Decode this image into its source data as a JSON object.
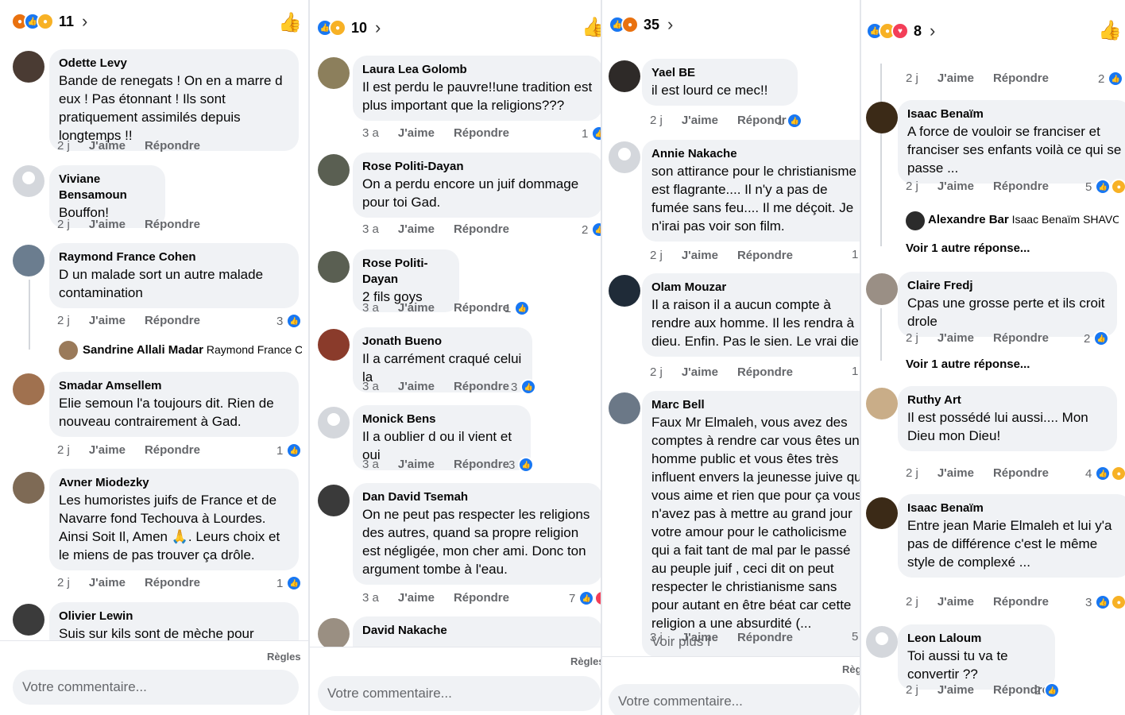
{
  "colors": {
    "like": "#1877f2",
    "haha": "#f7b125",
    "angry": "#e9710f",
    "love": "#f33e58",
    "bubble": "#f0f2f5"
  },
  "icons": {
    "like_button": "thumbs-up-icon",
    "chevron": "chevron-right-icon"
  },
  "panels": [
    {
      "reaction_count": "11",
      "comments": [
        {
          "name": "Odette Levy",
          "text": "Bande de renegats ! On en a marre d eux ! Pas étonnant ! Ils sont pratiquement assimilés depuis longtemps !!",
          "time": "2 j",
          "like": "J'aime",
          "reply": "Répondre",
          "count": ""
        },
        {
          "name": "Viviane Bensamoun",
          "text": "Bouffon!",
          "time": "2 j",
          "like": "J'aime",
          "reply": "Répondre",
          "count": ""
        },
        {
          "name": "Raymond France Cohen",
          "text": "D un malade sort un autre malade contamination",
          "time": "2 j",
          "like": "J'aime",
          "reply": "Répondre",
          "count": "3"
        },
        {
          "name": "Smadar Amsellem",
          "text": "Elie semoun l'a toujours dit. Rien de nouveau contrairement à Gad.",
          "time": "2 j",
          "like": "J'aime",
          "reply": "Répondre",
          "count": "1"
        },
        {
          "name": "Avner Miodezky",
          "text": "Les humoristes juifs de France et de Navarre fond Techouva à Lourdes. Ainsi Soit Il, Amen 🙏. Leurs choix et le miens de pas trouver ça drôle.",
          "time": "2 j",
          "like": "J'aime",
          "reply": "Répondre",
          "count": "1"
        },
        {
          "name": "Olivier Lewin",
          "text": "Suis sur kils sont de mèche pour",
          "time": "",
          "like": "",
          "reply": "",
          "count": ""
        }
      ],
      "replies": [
        {
          "name": "Sandrine Allali Madar",
          "text": "Raymond France Coh..."
        }
      ],
      "regles": "Règles",
      "placeholder": "Votre commentaire..."
    },
    {
      "reaction_count": "10",
      "comments": [
        {
          "name": "Laura Lea Golomb",
          "text": "Il est perdu le pauvre!!une tradition est plus important que la religions???",
          "time": "3 a",
          "like": "J'aime",
          "reply": "Répondre",
          "count": "1"
        },
        {
          "name": "Rose Politi-Dayan",
          "text": "On a perdu encore un juif dommage pour toi Gad.",
          "time": "3 a",
          "like": "J'aime",
          "reply": "Répondre",
          "count": "2"
        },
        {
          "name": "Rose Politi-Dayan",
          "text": "2 fils goys",
          "time": "3 a",
          "like": "J'aime",
          "reply": "Répondre",
          "count": "1"
        },
        {
          "name": "Jonath Bueno",
          "text": "Il a carrément craqué celui la",
          "time": "3 a",
          "like": "J'aime",
          "reply": "Répondre",
          "count": "3"
        },
        {
          "name": "Monick Bens",
          "text": "Il a oublier d ou il vient et oui",
          "time": "3 a",
          "like": "J'aime",
          "reply": "Répondre",
          "count": "3"
        },
        {
          "name": "Dan David Tsemah",
          "text": "On ne peut pas respecter les religions des autres, quand sa propre religion est négligée, mon cher ami. Donc ton argument tombe à l'eau.",
          "time": "3 a",
          "like": "J'aime",
          "reply": "Répondre",
          "count": "7"
        },
        {
          "name": "David Nakache",
          "text": "",
          "time": "",
          "like": "",
          "reply": "",
          "count": ""
        }
      ],
      "regles": "Règles",
      "placeholder": "Votre commentaire..."
    },
    {
      "reaction_count": "35",
      "comments": [
        {
          "name": "Yael BE",
          "text": "il est lourd ce mec!!",
          "time": "2 j",
          "like": "J'aime",
          "reply": "Répondre",
          "count": "1"
        },
        {
          "name": "Annie Nakache",
          "text": "son attirance pour le christianisme est flagrante.... Il n'y a pas de fumée sans feu.... Il me déçoit. Je n'irai pas voir son film.",
          "time": "2 j",
          "like": "J'aime",
          "reply": "Répondre",
          "count": "1"
        },
        {
          "name": "Olam Mouzar",
          "text": "Il a raison il a aucun compte à rendre aux homme. Il les rendra à dieu. Enfin. Pas le sien. Le vrai dieu",
          "time": "2 j",
          "like": "J'aime",
          "reply": "Répondre",
          "count": "1"
        },
        {
          "name": "Marc Bell",
          "text": "Faux Mr Elmaleh, vous avez des comptes à rendre car vous êtes un homme public et vous êtes très influent envers la jeunesse juive qui vous aime et rien que pour ça vous n'avez pas à mettre au grand jour votre amour pour le catholicisme qui a fait tant de mal par le passé au peuple juif , ceci dit on peut respecter le christianisme sans pour autant en être béat car cette religion a une absurdité (...",
          "more": "Voir plus f",
          "time": "3 j",
          "like": "J'aime",
          "reply": "Répondre",
          "count": "5"
        }
      ],
      "regles": "Règl",
      "placeholder": "Votre commentaire..."
    },
    {
      "reaction_count": "8",
      "top_row": {
        "time": "2 j",
        "like": "J'aime",
        "reply": "Répondre",
        "count": "2"
      },
      "comments": [
        {
          "name": "Isaac Benaïm",
          "text": "A force de vouloir se franciser et franciser ses enfants voilà ce qui se passe ...",
          "time": "2 j",
          "like": "J'aime",
          "reply": "Répondre",
          "count": "5"
        },
        {
          "name": "Claire Fredj",
          "text": "Cpas une grosse perte  et ils croit drole",
          "time": "2 j",
          "like": "J'aime",
          "reply": "Répondre",
          "count": "2"
        },
        {
          "name": "Ruthy Art",
          "text": "Il est possédé lui aussi.... Mon Dieu mon Dieu!",
          "time": "2 j",
          "like": "J'aime",
          "reply": "Répondre",
          "count": "4"
        },
        {
          "name": "Isaac Benaïm",
          "text": "Entre jean Marie Elmaleh et lui y'a pas de différence c'est le même style de complexé ...",
          "time": "2 j",
          "like": "J'aime",
          "reply": "Répondre",
          "count": "3"
        },
        {
          "name": "Leon Laloum",
          "text": "Toi aussi tu va te convertir ??",
          "time": "2 j",
          "like": "J'aime",
          "reply": "Répondre",
          "count": "2"
        }
      ],
      "replies": [
        {
          "name": "Alexandre Bar",
          "text": "Isaac Benaïm SHAVOUA TOV..."
        }
      ],
      "more_replies_1": "Voir 1 autre réponse...",
      "more_replies_2": "Voir 1 autre réponse..."
    }
  ]
}
